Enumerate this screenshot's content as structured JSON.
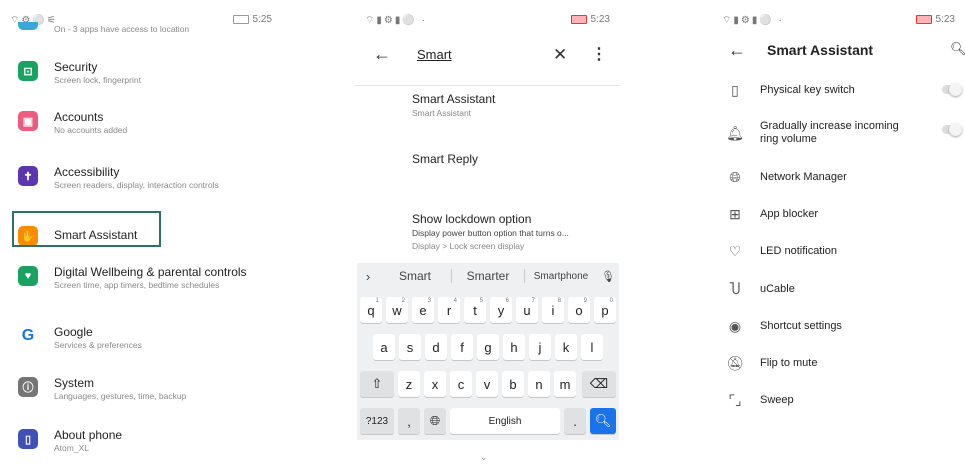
{
  "panel1": {
    "status": {
      "icons": "⌔⚙⚪⚟",
      "time": "5:25"
    },
    "partial_item_subtitle": "On - 3 apps have access to location",
    "items": [
      {
        "title": "Security",
        "subtitle": "Screen lock, fingerprint",
        "icon": "lock-icon",
        "color": "#1aa260",
        "glyph": "⊡"
      },
      {
        "title": "Accounts",
        "subtitle": "No accounts added",
        "icon": "account-icon",
        "color": "#ef5b7f",
        "glyph": "▣"
      },
      {
        "title": "Accessibility",
        "subtitle": "Screen readers, display, interaction controls",
        "icon": "accessibility-icon",
        "color": "#5e35b1",
        "glyph": "✝"
      },
      {
        "title": "Smart Assistant",
        "subtitle": "",
        "icon": "hand-icon",
        "color": "#fb8c00",
        "glyph": "✋"
      },
      {
        "title": "Digital Wellbeing & parental controls",
        "subtitle": "Screen time, app timers, bedtime schedules",
        "icon": "wellbeing-icon",
        "color": "#1aa260",
        "glyph": "♥"
      },
      {
        "title": "Google",
        "subtitle": "Services & preferences",
        "icon": "google-icon",
        "color": "#ffffff",
        "glyph": "G"
      },
      {
        "title": "System",
        "subtitle": "Languages, gestures, time, backup",
        "icon": "info-icon",
        "color": "#757575",
        "glyph": "ⓘ"
      },
      {
        "title": "About phone",
        "subtitle": "Atom_XL",
        "icon": "phone-icon",
        "color": "#3f51b5",
        "glyph": "▯"
      }
    ]
  },
  "panel2": {
    "status": {
      "icons": "⌔▮⚙▮⚪ ·",
      "time": "5:23"
    },
    "query": "Smart",
    "results": [
      {
        "title": "Smart Assistant",
        "subtitle": "Smart Assistant",
        "detail": ""
      },
      {
        "title": "Smart Reply",
        "subtitle": "",
        "detail": ""
      },
      {
        "title": "Show lockdown option",
        "subtitle": "Display power button option that turns o...",
        "detail": "Display > Lock screen display"
      }
    ],
    "keyboard": {
      "suggestions": [
        "Smart",
        "Smarter",
        "Smartphone"
      ],
      "row1": [
        [
          "q",
          "1"
        ],
        [
          "w",
          "2"
        ],
        [
          "e",
          "3"
        ],
        [
          "r",
          "4"
        ],
        [
          "t",
          "5"
        ],
        [
          "y",
          "6"
        ],
        [
          "u",
          "7"
        ],
        [
          "i",
          "8"
        ],
        [
          "o",
          "9"
        ],
        [
          "p",
          "0"
        ]
      ],
      "row2": [
        "a",
        "s",
        "d",
        "f",
        "g",
        "h",
        "j",
        "k",
        "l"
      ],
      "row3": [
        "z",
        "x",
        "c",
        "v",
        "b",
        "n",
        "m"
      ],
      "symbols_label": "?123",
      "comma_label": ",",
      "space_label": "English",
      "period_label": "."
    }
  },
  "panel3": {
    "status": {
      "icons": "⌔▮⚙▮⚪ ·",
      "time": "5:23"
    },
    "title": "Smart Assistant",
    "items": [
      {
        "label": "Physical key switch",
        "icon": "phone-outline-icon",
        "glyph": "▯",
        "toggle": true
      },
      {
        "label": "Gradually increase incoming ring volume",
        "icon": "bell-icon",
        "glyph": "🔔︎",
        "toggle": true
      },
      {
        "label": "Network Manager",
        "icon": "globe-icon",
        "glyph": "🌐︎",
        "toggle": false
      },
      {
        "label": "App blocker",
        "icon": "app-grid-icon",
        "glyph": "⊞",
        "toggle": false
      },
      {
        "label": "LED notification",
        "icon": "bulb-icon",
        "glyph": "♡",
        "toggle": false
      },
      {
        "label": "uCable",
        "icon": "cable-icon",
        "glyph": "Ⴎ",
        "toggle": false
      },
      {
        "label": "Shortcut settings",
        "icon": "target-icon",
        "glyph": "◉",
        "toggle": false
      },
      {
        "label": "Flip to mute",
        "icon": "bell-off-icon",
        "glyph": "🔕︎",
        "toggle": false
      },
      {
        "label": "Sweep",
        "icon": "sweep-icon",
        "glyph": "⌜⌟",
        "toggle": false
      }
    ]
  }
}
